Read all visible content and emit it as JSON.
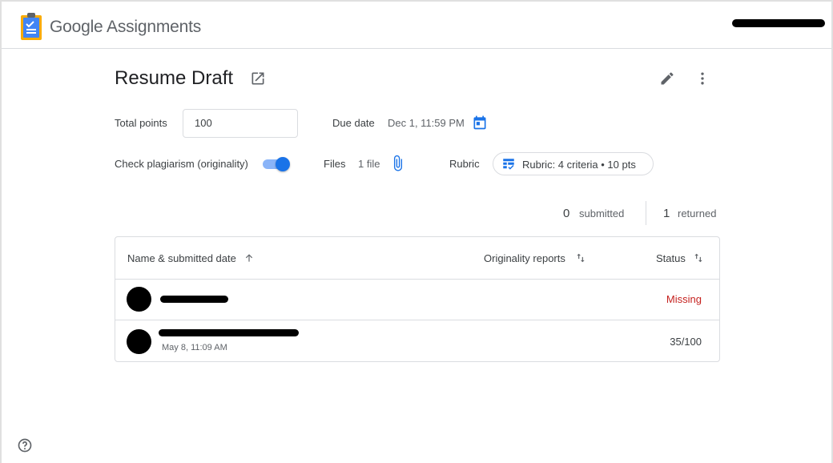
{
  "app": {
    "brand": "Google",
    "product": "Assignments"
  },
  "assignment": {
    "title": "Resume Draft",
    "total_points_label": "Total points",
    "total_points_value": "100",
    "due_date_label": "Due date",
    "due_date_value": "Dec 1, 11:59 PM",
    "plagiarism_label": "Check plagiarism (originality)",
    "plagiarism_enabled": true,
    "files_label": "Files",
    "files_value": "1 file",
    "rubric_label": "Rubric",
    "rubric_chip": "Rubric: 4 criteria • 10 pts"
  },
  "stats": {
    "submitted_count": "0",
    "submitted_label": "submitted",
    "returned_count": "1",
    "returned_label": "returned"
  },
  "table": {
    "headers": {
      "name": "Name & submitted date",
      "originality": "Originality reports",
      "status": "Status"
    },
    "rows": [
      {
        "date": "",
        "status": "Missing"
      },
      {
        "date": "May 8, 11:09 AM",
        "status": "35/100"
      }
    ]
  },
  "colors": {
    "accent": "#1a73e8",
    "missing": "#c5221f",
    "border": "#dadce0"
  }
}
